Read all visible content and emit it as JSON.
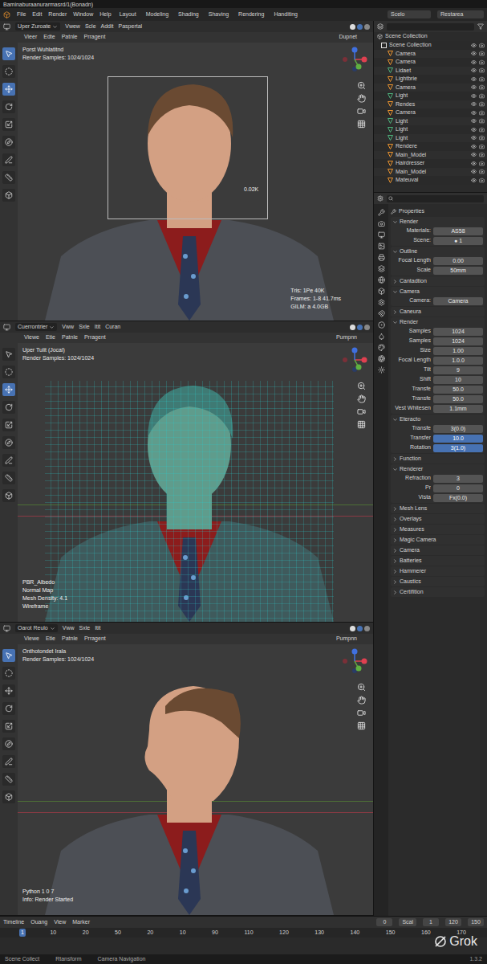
{
  "window": {
    "title": "Baminaburaanurarmasrd/1(Bonadn)"
  },
  "menu": [
    "File",
    "Edit",
    "Render",
    "Window",
    "Help"
  ],
  "workspaces": [
    {
      "label": "Layout",
      "selected": false
    },
    {
      "label": "Modeling",
      "selected": false
    },
    {
      "label": "Shading",
      "selected": false
    },
    {
      "label": "Shaving",
      "selected": false
    },
    {
      "label": "Rendering",
      "selected": false
    },
    {
      "label": "Handiting",
      "selected": false
    }
  ],
  "scene_field": "Scelo",
  "view_layer_field": "Restarea",
  "viewports": [
    {
      "kind": "render",
      "mode": "Uper Zuroate",
      "menus": [
        "Vwew",
        "Scle",
        "Addit",
        "Paspertal"
      ],
      "submenus": [
        "Vieer",
        "Edte",
        "Patnle",
        "Prragent"
      ],
      "shading": "Dupnet",
      "overlay": [
        "Porst Wuhlatitnd",
        "Render Samples: 1024/1024"
      ],
      "annotation": "0.02K",
      "stats": [
        "Tris: 1Pe 40K",
        "Frames: 1-8 41.7ms",
        "GILM: a 4.0GB"
      ],
      "notes": [],
      "tools": [
        {
          "selected": true
        },
        {
          "selected": false
        },
        {
          "selected": true
        },
        {
          "selected": false
        },
        {
          "selected": false
        },
        {
          "selected": false
        },
        {
          "selected": false
        },
        {
          "selected": false
        },
        {
          "selected": false
        }
      ]
    },
    {
      "kind": "wireframe",
      "mode": "Cuerrontrier",
      "menus": [
        "Vww",
        "Sxle",
        "Itit",
        "Curan"
      ],
      "submenus": [
        "Viewe",
        "Etie",
        "Patnle",
        "Prragent"
      ],
      "shading": "Pumpnn",
      "overlay": [
        "Uper Tulit (Jocal)",
        "Render Samples: 1024/1024"
      ],
      "annotation": "",
      "stats": [],
      "notes": [
        "PBR_Albedo",
        "Normal Map",
        "Mesh Density: 4.1",
        "Wireframe"
      ],
      "tools": [
        {
          "selected": false
        },
        {
          "selected": false
        },
        {
          "selected": true
        },
        {
          "selected": false
        },
        {
          "selected": false
        },
        {
          "selected": false
        },
        {
          "selected": false
        },
        {
          "selected": false
        },
        {
          "selected": false
        }
      ]
    },
    {
      "kind": "profile",
      "mode": "Oarot Reulo",
      "menus": [
        "Vww",
        "Sxle",
        "Itit"
      ],
      "submenus": [
        "Viewe",
        "Etie",
        "Patnle",
        "Prragent"
      ],
      "shading": "Pumpnn",
      "overlay": [
        "Onthotondet Irala",
        "Render Samples: 1024/1024"
      ],
      "annotation": "",
      "stats": [],
      "notes": [
        "Python 1 0 7",
        "Info: Render Started"
      ],
      "tools": [
        {
          "selected": true
        },
        {
          "selected": false
        },
        {
          "selected": false
        },
        {
          "selected": false
        },
        {
          "selected": false
        },
        {
          "selected": false
        },
        {
          "selected": false
        },
        {
          "selected": false
        },
        {
          "selected": false
        }
      ]
    }
  ],
  "outliner": {
    "title": "Scene Collection",
    "items": [
      {
        "label": "Scene Collection",
        "kind": "collection",
        "depth": 0,
        "visible": true,
        "color": "#e0e0e0"
      },
      {
        "label": "Camera",
        "kind": "camera",
        "depth": 1,
        "visible": true,
        "color": "#e8922e"
      },
      {
        "label": "Camera",
        "kind": "camera",
        "depth": 1,
        "visible": true,
        "color": "#e8922e"
      },
      {
        "label": "Lidaet",
        "kind": "light",
        "depth": 1,
        "visible": true,
        "color": "#4caf7a"
      },
      {
        "label": "Lightbrie",
        "kind": "light",
        "depth": 1,
        "visible": true,
        "color": "#e8922e"
      },
      {
        "label": "Camera",
        "kind": "camera",
        "depth": 1,
        "visible": true,
        "color": "#e8922e"
      },
      {
        "label": "Light",
        "kind": "light",
        "depth": 1,
        "visible": true,
        "color": "#4caf7a"
      },
      {
        "label": "Rendes",
        "kind": "camera",
        "depth": 1,
        "visible": true,
        "color": "#e8922e"
      },
      {
        "label": "Camera",
        "kind": "camera",
        "depth": 1,
        "visible": true,
        "color": "#e8922e"
      },
      {
        "label": "Light",
        "kind": "light",
        "depth": 1,
        "visible": true,
        "color": "#4caf7a"
      },
      {
        "label": "Light",
        "kind": "light",
        "depth": 1,
        "visible": true,
        "color": "#4caf7a"
      },
      {
        "label": "Light",
        "kind": "light",
        "depth": 1,
        "visible": true,
        "color": "#4caf7a"
      },
      {
        "label": "Rendere",
        "kind": "camera",
        "depth": 1,
        "visible": true,
        "color": "#e8922e"
      },
      {
        "label": "Main_Model",
        "kind": "mesh",
        "depth": 1,
        "visible": true,
        "color": "#e8922e"
      },
      {
        "label": "Hairdresser",
        "kind": "mesh",
        "depth": 1,
        "visible": true,
        "color": "#e8922e"
      },
      {
        "label": "Main_Model",
        "kind": "mesh",
        "depth": 1,
        "visible": true,
        "color": "#e8922e"
      },
      {
        "label": "Mateuval",
        "kind": "mesh",
        "depth": 1,
        "visible": true,
        "color": "#e8922e"
      }
    ]
  },
  "properties": {
    "title": "Properties",
    "sections": [
      {
        "title": "Render",
        "expanded": true,
        "rows": [
          {
            "label": "Materials:",
            "value": "AS58",
            "highlighted": false
          },
          {
            "label": "Scene:",
            "value": "● 1",
            "highlighted": false
          }
        ]
      },
      {
        "title": "Outline",
        "expanded": true,
        "rows": [
          {
            "label": "Focal Length",
            "value": "0.00",
            "highlighted": false
          },
          {
            "label": "Scale",
            "value": "50mm",
            "highlighted": false
          }
        ]
      },
      {
        "title": "Cantadtion",
        "expanded": false,
        "rows": []
      },
      {
        "title": "Camera",
        "expanded": true,
        "rows": [
          {
            "label": "Camera:",
            "value": "Camera",
            "highlighted": false
          }
        ]
      },
      {
        "title": "Caneura",
        "expanded": false,
        "rows": []
      },
      {
        "title": "Render",
        "expanded": true,
        "rows": [
          {
            "label": "Samples",
            "value": "1024",
            "highlighted": false
          },
          {
            "label": "Samples",
            "value": "1024",
            "highlighted": false
          },
          {
            "label": "Size",
            "value": "1.00",
            "highlighted": false
          },
          {
            "label": "Focal Length",
            "value": "1.0.0",
            "highlighted": false
          },
          {
            "label": "Tilt",
            "value": "9",
            "highlighted": false
          },
          {
            "label": "Shift",
            "value": "10",
            "highlighted": false
          },
          {
            "label": "Transfe",
            "value": "50.0",
            "highlighted": false
          },
          {
            "label": "Transfe",
            "value": "50.0",
            "highlighted": false
          },
          {
            "label": "Vest Whitesen",
            "value": "1.1mm",
            "highlighted": false
          }
        ]
      },
      {
        "title": "Eteracto",
        "expanded": true,
        "rows": [
          {
            "label": "Transfe",
            "value": "3(0.0)",
            "highlighted": false
          },
          {
            "label": "Transfer",
            "value": "10.0",
            "highlighted": true
          },
          {
            "label": "Rotation",
            "value": "3(1.0)",
            "highlighted": true
          }
        ]
      },
      {
        "title": "Function",
        "expanded": false,
        "rows": []
      },
      {
        "title": "Renderer",
        "expanded": true,
        "rows": [
          {
            "label": "Refraction",
            "value": "3",
            "highlighted": false
          },
          {
            "label": "Pr",
            "value": "0",
            "highlighted": false
          },
          {
            "label": "Vista",
            "value": "Fx(0.0)",
            "highlighted": false
          }
        ]
      },
      {
        "title": "Mesh Lens",
        "expanded": false,
        "rows": []
      },
      {
        "title": "Overlays",
        "expanded": false,
        "rows": []
      },
      {
        "title": "Measures",
        "expanded": false,
        "rows": []
      },
      {
        "title": "Magic Camera",
        "expanded": false,
        "rows": []
      },
      {
        "title": "Camera",
        "expanded": false,
        "rows": []
      },
      {
        "title": "Batteries",
        "expanded": false,
        "rows": []
      },
      {
        "title": "Hammerer",
        "expanded": false,
        "rows": []
      },
      {
        "title": "Caustics",
        "expanded": false,
        "rows": []
      },
      {
        "title": "Certifition",
        "expanded": false,
        "rows": []
      }
    ]
  },
  "timeline": {
    "menus": [
      "Timeline",
      "Ouang",
      "View",
      "Marker"
    ],
    "fields": [
      "0",
      "Scal",
      "1",
      "120",
      "150"
    ],
    "ticks": [
      {
        "label": "1",
        "selected": true
      },
      {
        "label": "10",
        "selected": false
      },
      {
        "label": "20",
        "selected": false
      },
      {
        "label": "50",
        "selected": false
      },
      {
        "label": "20",
        "selected": false
      },
      {
        "label": "10",
        "selected": false
      },
      {
        "label": "90",
        "selected": false
      },
      {
        "label": "110",
        "selected": false
      },
      {
        "label": "120",
        "selected": false
      },
      {
        "label": "130",
        "selected": false
      },
      {
        "label": "140",
        "selected": false
      },
      {
        "label": "150",
        "selected": false
      },
      {
        "label": "160",
        "selected": false
      },
      {
        "label": "170",
        "selected": false
      }
    ]
  },
  "status_bar": {
    "items": [
      "Scene Collect",
      "Rtansform",
      "Camera Navigation"
    ],
    "version": "1.3.2"
  },
  "watermark": "Grok"
}
